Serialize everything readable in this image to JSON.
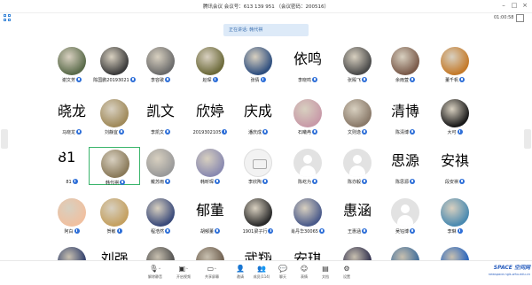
{
  "window": {
    "title": "腾讯会议  会议号：613 139 951  （会议密码：200516）",
    "controls": [
      "minimize-icon",
      "maximize-icon",
      "close-icon"
    ]
  },
  "top": {
    "timer": "01:00:58",
    "speaking_label": "正在讲话: 韩代祺"
  },
  "participants": [
    {
      "name": "谢文芳",
      "avatar_text": "",
      "type": "photo",
      "color": "#5a6b4a"
    },
    {
      "name": "陈国鹏20193021",
      "avatar_text": "",
      "type": "photo",
      "color": "#3b3b3b"
    },
    {
      "name": "李容歌",
      "avatar_text": "",
      "type": "photo",
      "color": "#6b6b6b"
    },
    {
      "name": "赵琛",
      "avatar_text": "",
      "type": "photo",
      "color": "#6c6a3a"
    },
    {
      "name": "张倩",
      "avatar_text": "",
      "type": "photo",
      "color": "#2f4f7f"
    },
    {
      "name": "李晓鸣",
      "avatar_text": "依鸣",
      "type": "text"
    },
    {
      "name": "张殿飞",
      "avatar_text": "",
      "type": "photo",
      "color": "#4a4a4a"
    },
    {
      "name": "余雨萱",
      "avatar_text": "",
      "type": "photo",
      "color": "#7a5a4a"
    },
    {
      "name": "董千帆",
      "avatar_text": "",
      "type": "photo",
      "color": "#c47a2a"
    },
    {
      "name": "马晓龙",
      "avatar_text": "晓龙",
      "type": "text"
    },
    {
      "name": "刘静宜",
      "avatar_text": "",
      "type": "photo",
      "color": "#a08a5a"
    },
    {
      "name": "李凯文",
      "avatar_text": "凯文",
      "type": "text"
    },
    {
      "name": "2019302105",
      "avatar_text": "欣婷",
      "type": "text"
    },
    {
      "name": "潘庆成",
      "avatar_text": "庆成",
      "type": "text"
    },
    {
      "name": "石曦冉",
      "avatar_text": "",
      "type": "photo",
      "color": "#c89aa8"
    },
    {
      "name": "文则逸",
      "avatar_text": "",
      "type": "photo",
      "color": "#8a7a6a"
    },
    {
      "name": "陈清博",
      "avatar_text": "清博",
      "type": "text"
    },
    {
      "name": "大可",
      "avatar_text": "",
      "type": "photo",
      "color": "#1a1a1a"
    },
    {
      "name": "81",
      "avatar_text": "81",
      "type": "text"
    },
    {
      "name": "韩代祺",
      "avatar_text": "",
      "type": "photo",
      "color": "#8a7a5a",
      "active": true
    },
    {
      "name": "戴苏雨",
      "avatar_text": "",
      "type": "photo",
      "color": "#9a9a9a"
    },
    {
      "name": "韩昕琛",
      "avatar_text": "",
      "type": "photo",
      "color": "#8a8ab0"
    },
    {
      "name": "李欣陶",
      "avatar_text": "",
      "type": "cam"
    },
    {
      "name": "陈屹为",
      "avatar_text": "",
      "type": "gray"
    },
    {
      "name": "陈亦毅",
      "avatar_text": "",
      "type": "gray"
    },
    {
      "name": "陈思源",
      "avatar_text": "思源",
      "type": "text"
    },
    {
      "name": "段安祺",
      "avatar_text": "安祺",
      "type": "text"
    },
    {
      "name": "阿白",
      "avatar_text": "",
      "type": "photo",
      "color": "#f0c0a0"
    },
    {
      "name": "贺敏",
      "avatar_text": "",
      "type": "photo",
      "color": "#c4a060"
    },
    {
      "name": "程浩然",
      "avatar_text": "",
      "type": "photo",
      "color": "#3a4a7a"
    },
    {
      "name": "胡郁董",
      "avatar_text": "郁董",
      "type": "text"
    },
    {
      "name": "1901梁子行",
      "avatar_text": "",
      "type": "photo",
      "color": "#2a2a2a"
    },
    {
      "name": "肖丹华30065",
      "avatar_text": "",
      "type": "photo",
      "color": "#4a5a8a"
    },
    {
      "name": "王惠涵",
      "avatar_text": "惠涵",
      "type": "text"
    },
    {
      "name": "吴钰博",
      "avatar_text": "",
      "type": "gray"
    },
    {
      "name": "李琳",
      "avatar_text": "",
      "type": "photo",
      "color": "#4a8ab0"
    }
  ],
  "partial_row": [
    {
      "avatar_text": "",
      "type": "photo",
      "color": "#2a3a6a"
    },
    {
      "avatar_text": "刘强",
      "type": "text"
    },
    {
      "avatar_text": "",
      "type": "photo",
      "color": "#4a4a4a"
    },
    {
      "avatar_text": "",
      "type": "photo",
      "color": "#6a5a4a"
    },
    {
      "avatar_text": "武翔",
      "type": "text"
    },
    {
      "avatar_text": "安琪",
      "type": "text"
    },
    {
      "avatar_text": "",
      "type": "photo",
      "color": "#2a2a4a"
    },
    {
      "avatar_text": "",
      "type": "photo",
      "color": "#3a6a9a"
    },
    {
      "avatar_text": "",
      "type": "photo",
      "color": "#1e5fbf"
    }
  ],
  "toolbar": [
    {
      "label": "解除静音",
      "icon": "mic-muted-icon"
    },
    {
      "label": "开启视频",
      "icon": "video-off-icon"
    },
    {
      "label": "共享屏幕",
      "icon": "share-screen-icon"
    },
    {
      "label": "邀请",
      "icon": "invite-icon"
    },
    {
      "label": "成员(114)",
      "icon": "members-icon"
    },
    {
      "label": "聊天",
      "icon": "chat-icon"
    },
    {
      "label": "表情",
      "icon": "emoji-icon"
    },
    {
      "label": "文档",
      "icon": "document-icon"
    },
    {
      "label": "设置",
      "icon": "settings-icon"
    }
  ],
  "watermark": {
    "logo": "SPACE 空间网",
    "url": "newspace.ngis.whu.edu.cn"
  }
}
